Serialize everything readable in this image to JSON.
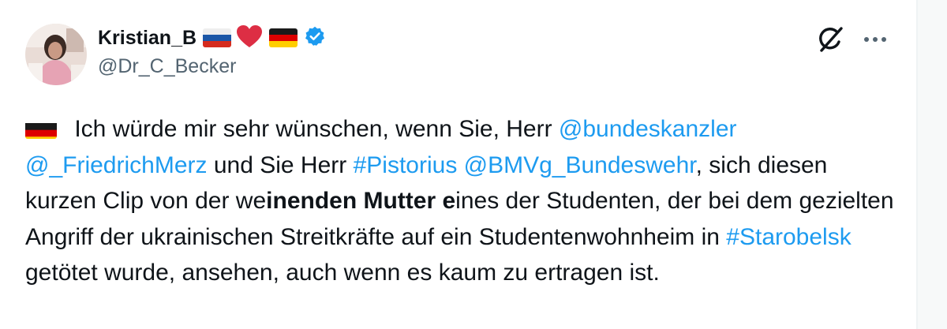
{
  "author": {
    "display_name": "Kristian_B",
    "handle": "@Dr_C_Becker",
    "name_emojis": [
      "russia-flag",
      "red-heart",
      "germany-flag"
    ],
    "verified": true
  },
  "actions": {
    "grok_icon": "grok-icon",
    "more_icon": "more-icon"
  },
  "tweet": {
    "lead_flag": "germany-flag",
    "segments": [
      {
        "text": " Ich würde mir sehr wünschen, wenn Sie, Herr ",
        "style": "plain"
      },
      {
        "text": "@bundeskanzler",
        "style": "link"
      },
      {
        "text": " ",
        "style": "plain"
      },
      {
        "text": "@_FriedrichMerz",
        "style": "link"
      },
      {
        "text": " und Sie Herr ",
        "style": "plain"
      },
      {
        "text": "#Pistorius",
        "style": "link"
      },
      {
        "text": " ",
        "style": "plain"
      },
      {
        "text": "@BMVg_Bundeswehr",
        "style": "link"
      },
      {
        "text": ", sich diesen kurzen Clip von der we",
        "style": "plain"
      },
      {
        "text": "inenden Mutter e",
        "style": "bold"
      },
      {
        "text": "ines der Studenten, der bei dem gezielten Angriff der ukrainischen Streitkräfte auf ein Studentenwohnheim in ",
        "style": "plain"
      },
      {
        "text": "#Starobelsk",
        "style": "link"
      },
      {
        "text": " getötet wurde, ansehen, auch wenn es kaum zu ertragen ist.",
        "style": "plain"
      }
    ]
  },
  "colors": {
    "link": "#1d9bf0",
    "text": "#0f1419",
    "secondary": "#536471",
    "verified": "#1d9bf0"
  }
}
